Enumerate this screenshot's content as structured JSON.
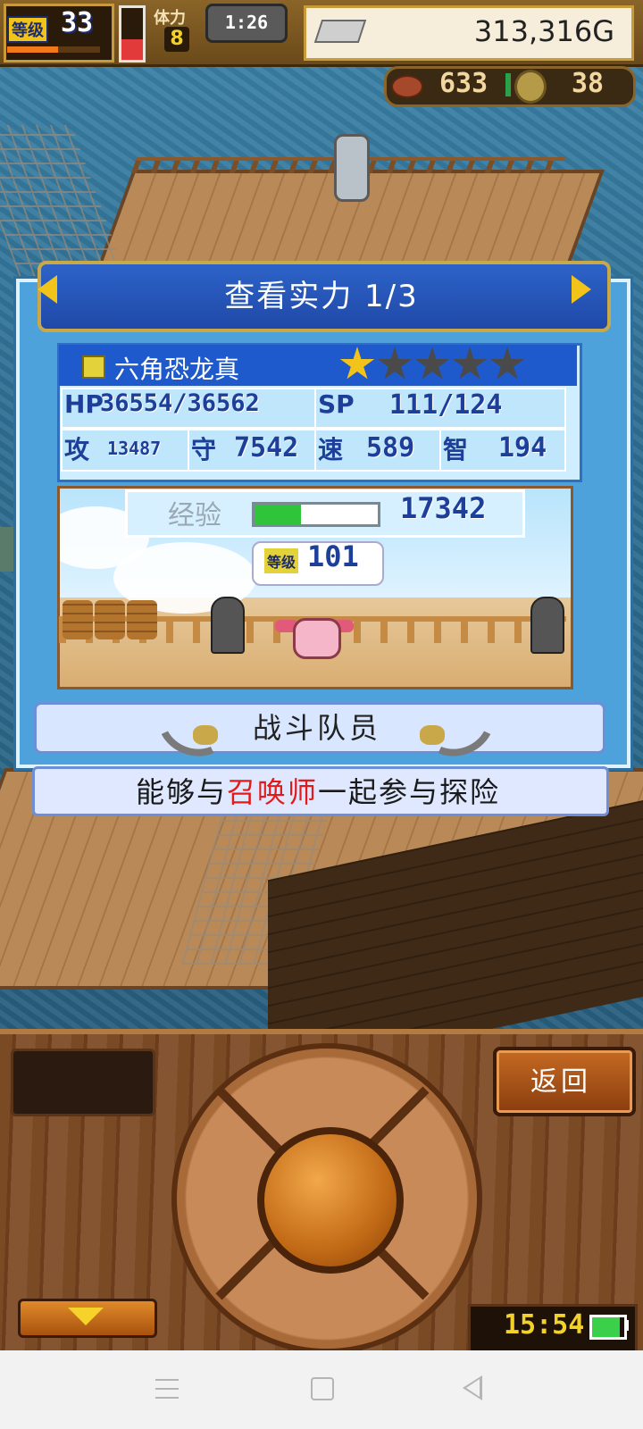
{
  "hud": {
    "level_label": "等级",
    "level": "33",
    "level_exp_fraction": 0.55,
    "hp_fraction": 0.4,
    "stamina_label": "体力",
    "stamina": "8",
    "timer": "1:26",
    "gold": "313,316G",
    "resource_food": "633",
    "resource_coin": "38"
  },
  "dialog": {
    "title": "查看实力 1/3",
    "character_name": "六角恐龙真",
    "stars_filled": 1,
    "stars_total": 5,
    "stats": {
      "hp_label": "HP",
      "hp": "36554/36562",
      "sp_label": "SP",
      "sp": "111/124",
      "atk_label": "攻",
      "atk": "13487",
      "def_label": "守",
      "def": "7542",
      "spd_label": "速",
      "spd": "589",
      "int_label": "智",
      "int": "194"
    },
    "exp_label": "经验",
    "exp_value": "17342",
    "exp_fraction": 0.38,
    "level_tag": "等级",
    "level_value": "101",
    "role": "战斗队员",
    "description_pre": "能够与",
    "description_highlight": "召唤师",
    "description_post": "一起参与探险"
  },
  "panel": {
    "back_label": "返回",
    "clock": "15:54",
    "battery_fraction": 0.85
  },
  "colors": {
    "dialog_blue": "#4da2dc",
    "header_blue": "#1f49a8",
    "gold_accent": "#f2c318",
    "highlight_red": "#e21a1a",
    "wood": "#7a4a24"
  }
}
